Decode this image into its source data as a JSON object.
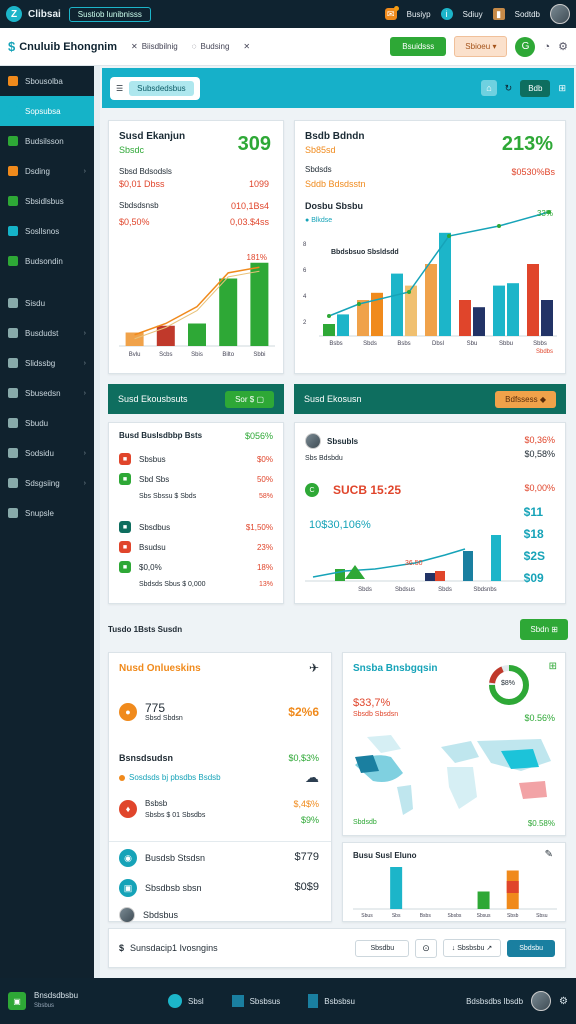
{
  "topbar": {
    "logo": "Z",
    "title": "Clibsai",
    "pill": "Sustiob lunibnisss",
    "right": [
      "Busiyp",
      "Sdiuy",
      "Sodtdb"
    ]
  },
  "navbar": {
    "brand": "Cnuluib Ehongnim",
    "links": [
      "Biisdbilnig",
      "Budsing"
    ],
    "btn_green": "Bsuidsss",
    "btn_peach": "Sbioeu"
  },
  "sidebar": {
    "items": [
      {
        "label": "Sbousolba",
        "color": "#f08a1c",
        "active": false
      },
      {
        "label": "Sopsubsa",
        "color": "#15b3c8",
        "active": true
      },
      {
        "label": "Budsilsson",
        "color": "#2ea836",
        "active": false
      },
      {
        "label": "Dsding",
        "color": "#f08a1c",
        "active": false,
        "chev": true
      },
      {
        "label": "Sbsidlsbus",
        "color": "#2ea836",
        "active": false
      },
      {
        "label": "Sosllsnos",
        "color": "#15b3c8",
        "active": false
      },
      {
        "label": "Budsondin",
        "color": "#2ea836",
        "active": false
      },
      {
        "label": "Sisdu",
        "color": "#8aa",
        "active": false
      },
      {
        "label": "Busdudst",
        "color": "#8aa",
        "active": false,
        "chev": true
      },
      {
        "label": "Slidssbg",
        "color": "#8aa",
        "active": false,
        "chev": true
      },
      {
        "label": "Sbusedsn",
        "color": "#8aa",
        "active": false,
        "chev": true
      },
      {
        "label": "Sbudu",
        "color": "#8aa",
        "active": false
      },
      {
        "label": "Sodsidu",
        "color": "#8aa",
        "active": false,
        "chev": true
      },
      {
        "label": "Sdsgsiing",
        "color": "#8aa",
        "active": false,
        "chev": true
      },
      {
        "label": "Snupsle",
        "color": "#8aa",
        "active": false
      }
    ]
  },
  "header": {
    "tab": "Subsdedsbus",
    "btn": "Bdb"
  },
  "card1": {
    "title": "Susd Ekanjun",
    "sub": "Sbsdc",
    "value": "309",
    "r1l": "Sbsd Bdsodsls",
    "r1v": "1099",
    "r2l": "$0,01 Dbss",
    "r3l": "Sbdsdsnsb",
    "r3v": "010,1Bs4",
    "r4l": "$0,50%",
    "r4v": "0,03.$4ss",
    "peak": "181%",
    "xt": [
      "Bvlu",
      "Scbs",
      "Sbis",
      "Bilto",
      "Sbbi"
    ]
  },
  "card2": {
    "title": "Bsdb Bdndn",
    "sub": "Sb85sd",
    "value": "213%",
    "r1l": "Sbdsds",
    "r1v": "$0530%Bs",
    "r2l": "Sddb Bdsdsstn",
    "lg1": "Dosbu Sbsbu",
    "lg2": "Blkdse",
    "lg3": "Bbdsbsuo Sbsldsdd",
    "tag": "Tug",
    "peak": "33%",
    "xt": [
      "Bsbs",
      "Sbds",
      "Bsbs",
      "Dbsl",
      "Sbu",
      "Sbbu",
      "Sbbs"
    ],
    "xt2": "Sbdbs"
  },
  "sect1": {
    "title": "Susd Ekousbsuts",
    "btn": "Sor $"
  },
  "sect2": {
    "title": "Susd Ekosusn",
    "btn": "Bdfssess"
  },
  "card3": {
    "title": "Busd Buslsdbbp Bsts",
    "val": "$056%",
    "rows": [
      {
        "l": "Sbsbus",
        "v": "$0%",
        "c": "#e0452b"
      },
      {
        "l": "Sbd Sbs",
        "v": "50%",
        "c": "#2ea836",
        "sub": "Sbs Sbssu $ Sbds",
        "sv": "58%"
      },
      {
        "l": "Sbsdbus",
        "v": "$1,50%",
        "c": "#0e6e5f"
      },
      {
        "l": "Bsudsu",
        "v": "23%",
        "c": "#e0452b"
      },
      {
        "l": "$0,0%",
        "v": "18%",
        "c": "#2ea836",
        "sub": "Sbdsds Sbus $ 0,000",
        "sv": "13%"
      }
    ]
  },
  "card4": {
    "title": "Sbsubls",
    "sub": "Sbs Bdsbdu",
    "v1": "$0,36%",
    "v2": "$0,58%",
    "big": "SUCB 15:25",
    "bigp": "$0,00%",
    "mid": "10$30,106%",
    "mid2": "36.50",
    "nums": [
      "$11",
      "$18",
      "$2S",
      "$09"
    ],
    "xt": [
      "Sbds",
      "Sbdsus",
      "Sbds",
      "Sbdsnbs"
    ]
  },
  "band": {
    "title": "Tusdo 1Bsts Susdn",
    "btn": "Sbdn"
  },
  "card5": {
    "title": "Nusd Onlueskins",
    "v1": "775",
    "v1s": "Sbsd Sbdsn",
    "v1r": "$2%6",
    "h2": "Bsnsdsudsn",
    "h2v": "$0,$3%",
    "lk": "Sosdsds bj pbsdbs Bsdsb",
    "k1": "Bsbsb",
    "k1v": "$,4$%",
    "k1s": "Sbsbs $ 01 Sbsdbs",
    "k1sv": "$9%",
    "p1": "Busdsb Stsdsn",
    "p1v": "$779",
    "p2": "Sbsdbsb sbsn",
    "p2v": "$0$9",
    "p3": "Sbdsbus"
  },
  "card6": {
    "title": "Snsba Bnsbgqsin",
    "v1": "$33,7%",
    "v1s": "Sbsdb Sbsdsn",
    "v1r": "$0.56%",
    "donut": "$8%",
    "bl": "Sbdsdb",
    "br": "$0.58%"
  },
  "card7": {
    "title": "Busu Susl Eluno",
    "xt": [
      "Sbus",
      "Sbs",
      "Bsbs",
      "Sbsbs",
      "Sbsus",
      "Sbsb",
      "Sbsu"
    ]
  },
  "search": {
    "label": "Sunsdacip1 Ivosngins",
    "b1": "Sbsdbu",
    "b2": "Sbsbsbu",
    "b3": "Sbdsbu"
  },
  "footer": {
    "left": "Bnsdsdbsbu",
    "left2": "Sbsbus",
    "b1": "Sbsl",
    "b2": "Sbsbsus",
    "b3": "Bsbsbsu",
    "right": "Bdsbsdbs Ibsdb"
  },
  "chart_data": [
    {
      "type": "bar",
      "categories": [
        "Bvlu",
        "Scbs",
        "Sbis",
        "Bilto",
        "Sbbi"
      ],
      "values": [
        12,
        18,
        20,
        60,
        74
      ],
      "line": [
        10,
        20,
        35,
        65,
        70
      ]
    },
    {
      "type": "bar",
      "categories": [
        "Bsbs",
        "Sbds",
        "Bsbs",
        "Dbsl",
        "Sbu",
        "Sbbu",
        "Sbbs"
      ],
      "series": [
        {
          "values": [
            10,
            30,
            52,
            60,
            30,
            42,
            60
          ]
        },
        {
          "values": [
            18,
            36,
            42,
            86,
            24,
            44,
            30
          ]
        }
      ]
    },
    {
      "type": "bar",
      "categories": [
        "Sbus",
        "Sbs",
        "Bsbs",
        "Sbsbs",
        "Sbsus",
        "Sbsb",
        "Sbsu"
      ],
      "values": [
        0,
        60,
        0,
        0,
        25,
        55,
        0
      ]
    }
  ]
}
